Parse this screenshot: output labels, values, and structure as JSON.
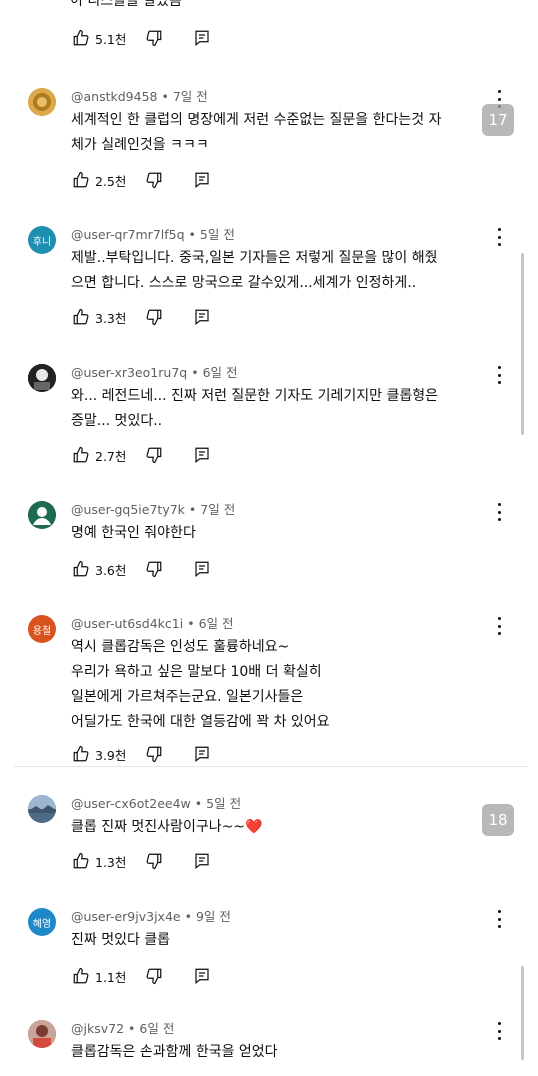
{
  "top_partial": {
    "text_fragment": "이 리스들을 날았음",
    "likes": "5.1천"
  },
  "comments": [
    {
      "handle": "@anstkd9458",
      "time": "7일 전",
      "avatar_text": "",
      "avatar_color": "#b8862b",
      "lines": [
        "세계적인 한 클럽의 명장에게 저런 수준없는 질문을 한다는것 자",
        "체가 실례인것을 ㅋㅋㅋ"
      ],
      "likes": "2.5천"
    },
    {
      "handle": "@user-qr7mr7lf5q",
      "time": "5일 전",
      "avatar_text": "후니",
      "avatar_color": "#1e8fb0",
      "lines": [
        "제발..부탁입니다. 중국,일본 기자들은  저렇게 질문을 많이  해줬",
        "으면 합니다. 스스로 망국으로 갈수있게...세계가  인정하게.."
      ],
      "likes": "3.3천"
    },
    {
      "handle": "@user-xr3eo1ru7q",
      "time": "6일 전",
      "avatar_text": "",
      "avatar_color": "#1a1a1a",
      "lines": [
        "와... 레전드네... 진짜 저런 질문한 기자도 기레기지만 클롭형은",
        "증말... 멋있다.."
      ],
      "likes": "2.7천"
    },
    {
      "handle": "@user-gq5ie7ty7k",
      "time": "7일 전",
      "avatar_text": "",
      "avatar_color": "#1f6b52",
      "lines": [
        "명예 한국인 줘야한다"
      ],
      "likes": "3.6천"
    },
    {
      "handle": "@user-ut6sd4kc1i",
      "time": "6일 전",
      "avatar_text": "용철",
      "avatar_color": "#d9531e",
      "lines": [
        "역시 클롭감독은 인성도 훌륭하네요~",
        "우리가 욕하고 싶은 말보다 10배 더 확실히",
        "일본에게 가르쳐주는군요. 일본기사들은",
        "어딜가도 한국에 대한 열등감에 꽉 차 있어요"
      ],
      "likes": "3.9천"
    },
    {
      "handle": "@user-cx6ot2ee4w",
      "time": "5일 전",
      "avatar_text": "",
      "avatar_color": "#6d8aa8",
      "lines": [
        "클롭 진짜 멋진사람이구나~~❤️"
      ],
      "likes": "1.3천"
    },
    {
      "handle": "@user-er9jv3jx4e",
      "time": "9일 전",
      "avatar_text": "혜영",
      "avatar_color": "#1e88c8",
      "lines": [
        "진짜 멋있다 클롭"
      ],
      "likes": "1.1천"
    },
    {
      "handle": "@jksv72",
      "time": "6일 전",
      "avatar_text": "",
      "avatar_color": "#a05a50",
      "lines": [
        "클롭감독은 손과함께 한국을 얻었다"
      ],
      "likes": ""
    }
  ],
  "page_badges": [
    "17",
    "18"
  ],
  "colors": {
    "meta_text": "#606060",
    "text": "#0f0f0f",
    "badge_bg": "#a0a0a0"
  }
}
